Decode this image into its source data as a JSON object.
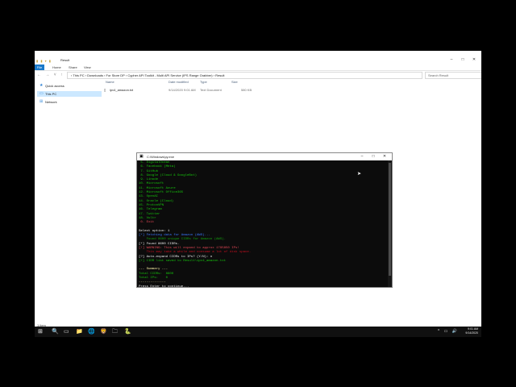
{
  "explorer": {
    "title": "Result",
    "window_controls": [
      "–",
      "□",
      "✕"
    ],
    "ribbon_tabs": [
      "File",
      "Home",
      "Share",
      "View"
    ],
    "nav_buttons": "← → ˅ ↑",
    "address": "›  This PC  ›  Downloads  ›  For Store DP  ›  Cypher API Toolkit - Multi API Service (IPS Range Grabber)  ›  Result",
    "search_placeholder": "Search Result",
    "nav_items": [
      {
        "label": "Quick access",
        "icon": "star-icon"
      },
      {
        "label": "This PC",
        "icon": "computer-icon"
      },
      {
        "label": "Network",
        "icon": "network-icon"
      }
    ],
    "columns": [
      "Name",
      "Date modified",
      "Type",
      "Size"
    ],
    "files": [
      {
        "name": "ipv4_amazon.txt",
        "date": "9/14/2020 9:01 AM",
        "type": "Text Document",
        "size": "580 KB"
      }
    ],
    "status": "1 item"
  },
  "cmd": {
    "title": "C:\\Windows\\py.exe",
    "lines": [
      {
        "t": " 5. DigitalOcean",
        "c": "g"
      },
      {
        "t": " 6. Facebook (Meta)",
        "c": "g"
      },
      {
        "t": " 7. GitHub",
        "c": "g"
      },
      {
        "t": " 8. Google (Cloud & GoogleBot)",
        "c": "g"
      },
      {
        "t": " 9. Linode",
        "c": "g"
      },
      {
        "t": "10. Microsoft",
        "c": "g"
      },
      {
        "t": "11. Microsoft Azure",
        "c": "g"
      },
      {
        "t": "12. Microsoft Office365",
        "c": "g"
      },
      {
        "t": "13. OpenAI",
        "c": "g"
      },
      {
        "t": "14. Oracle (Cloud)",
        "c": "g"
      },
      {
        "t": "15. ProtonVPN",
        "c": "g"
      },
      {
        "t": "16. Telegram",
        "c": "g"
      },
      {
        "t": "17. Twitter",
        "c": "g"
      },
      {
        "t": "18. Vultr",
        "c": "g"
      },
      {
        "t": " 0. Exit",
        "c": "r"
      },
      {
        "t": "",
        "c": "w"
      },
      {
        "t": "Select option: 1",
        "c": "br"
      },
      {
        "t": "[*] Fetching data for Amazon (AWS)...",
        "c": "b"
      },
      {
        "t": "    Found 8600 unique CIDRs for Amazon (AWS).",
        "c": "d"
      },
      {
        "t": "[*] Found 8600 CIDRs.",
        "c": "br"
      },
      {
        "t": "[!] WARNING: This will expand to approx 1795850 IPs!",
        "c": "r"
      },
      {
        "t": "    This may take a while and consume a lot of disk space.",
        "c": "dr"
      },
      {
        "t": "[?] Auto-expand CIDRs to IPs? (Y/N): n",
        "c": "br"
      },
      {
        "t": "[+] CIDR list saved to Result\\ipv4_amazon.txt",
        "c": "g"
      },
      {
        "t": "",
        "c": "w"
      },
      {
        "t": "--- Summary ---",
        "c": "y"
      },
      {
        "t": "Total CIDRs:  8600",
        "c": "g"
      },
      {
        "t": "Total IPs:    0",
        "c": "g"
      },
      {
        "t": "--------------",
        "c": "y"
      },
      {
        "t": "Press Enter to continue..._",
        "c": "br"
      }
    ]
  },
  "taskbar": {
    "start": "⊞",
    "icons": [
      "🔍",
      "▭",
      "📁",
      "🌐",
      "🦁",
      "🗀",
      "🐍"
    ],
    "tray_icons": "^ ▭ 🔊",
    "time": "9:01 AM",
    "date": "9/14/2020"
  }
}
